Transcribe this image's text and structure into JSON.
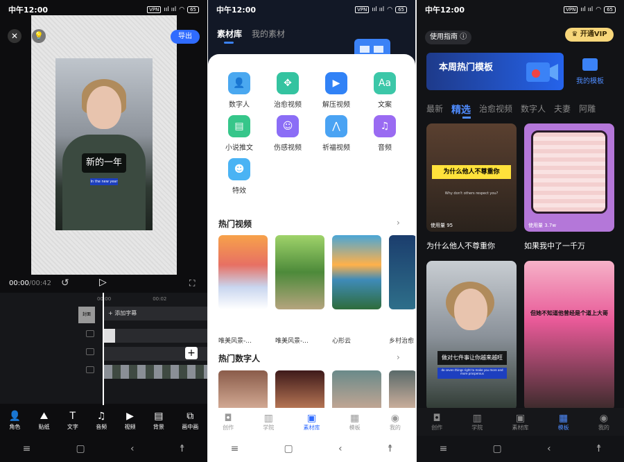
{
  "status": {
    "time": "中午12:00",
    "vpn": "VPN",
    "signal": "ııl ııl",
    "battery": "65"
  },
  "phone1": {
    "export_label": "导出",
    "caption_main": "新的一年",
    "caption_sub": "In the new year",
    "time_current": "00:00",
    "time_total": "/00:42",
    "ruler": [
      "00:00",
      "00:02"
    ],
    "cover_label": "封面",
    "add_subtitle": "+ 添加字幕",
    "tools": [
      "角色",
      "贴纸",
      "文字",
      "音频",
      "视频",
      "背景",
      "画中画"
    ]
  },
  "phone2": {
    "tabs": [
      "素材库",
      "我的素材"
    ],
    "categories": [
      "数字人",
      "治愈视频",
      "解压视频",
      "文案",
      "小说推文",
      "伤感视频",
      "祈福视频",
      "音频",
      "特效"
    ],
    "hot_videos_title": "热门视频",
    "hot_videos": [
      "唯美风景-...",
      "唯美风景-...",
      "心形云",
      "乡村治愈"
    ],
    "hot_humans_title": "热门数字人",
    "bottom_nav": [
      "创作",
      "学院",
      "素材库",
      "模板",
      "我的"
    ]
  },
  "phone3": {
    "guide": "使用指南",
    "vip": "开通VIP",
    "banner": "本周热门模板",
    "my_templates": "我的模板",
    "tabs": [
      "最新",
      "精选",
      "治愈视频",
      "数字人",
      "夫妻",
      "阿雕"
    ],
    "cards": [
      {
        "title": "为什么他人不尊重你",
        "usage": "使用量 95",
        "caption": "为什么他人不尊重你",
        "sub": "Why don't others respect you?"
      },
      {
        "title": "如果我中了一千万",
        "usage": "使用量 3.7w"
      },
      {
        "caption": "做对七件事让你越来越旺",
        "sub": "do seven things right to make you more and more prosperous"
      },
      {
        "caption": "但她不知道他曾经是个道上大哥"
      }
    ],
    "bottom_nav": [
      "创作",
      "学院",
      "素材库",
      "模板",
      "我的"
    ]
  }
}
